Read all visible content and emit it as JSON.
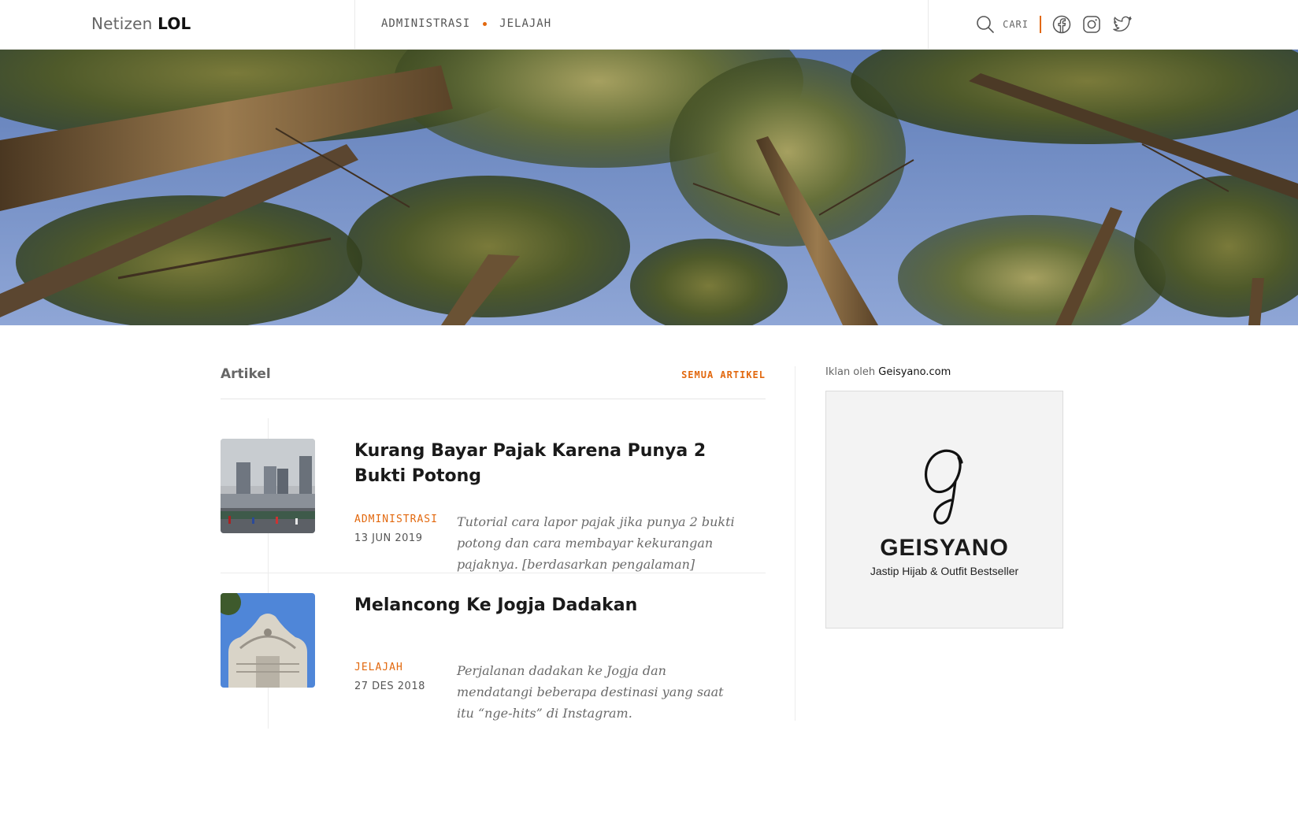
{
  "header": {
    "logo_light": "Netizen",
    "logo_bold": "LOL",
    "nav": [
      {
        "label": "ADMINISTRASI"
      },
      {
        "label": "JELAJAH"
      }
    ],
    "search_label": "CARI",
    "social_icons": [
      "facebook-icon",
      "instagram-icon",
      "twitter-icon"
    ]
  },
  "articles_section": {
    "title": "Artikel",
    "all_link": "SEMUA ARTIKEL",
    "items": [
      {
        "title": "Kurang Bayar Pajak Karena Punya 2 Bukti Potong",
        "category": "ADMINISTRASI",
        "date": "13 JUN 2019",
        "excerpt": "Tutorial cara lapor pajak jika punya 2 bukti potong dan cara membayar kekurangan pajaknya. [berdasarkan pengalaman]"
      },
      {
        "title": "Melancong Ke Jogja Dadakan",
        "category": "JELAJAH",
        "date": "27 DES 2018",
        "excerpt": "Perjalanan dadakan ke Jogja dan mendatangi beberapa destinasi yang saat itu “nge-hits” di Instagram."
      }
    ]
  },
  "sidebar": {
    "ad_prefix": "Iklan oleh",
    "ad_sponsor": "Geisyano.com",
    "ad_brand": "GEISYANO",
    "ad_tagline": "Jastip Hijab & Outfit Bestseller"
  },
  "colors": {
    "accent": "#e2680e",
    "text": "#1a1a1a",
    "muted": "#666666"
  }
}
